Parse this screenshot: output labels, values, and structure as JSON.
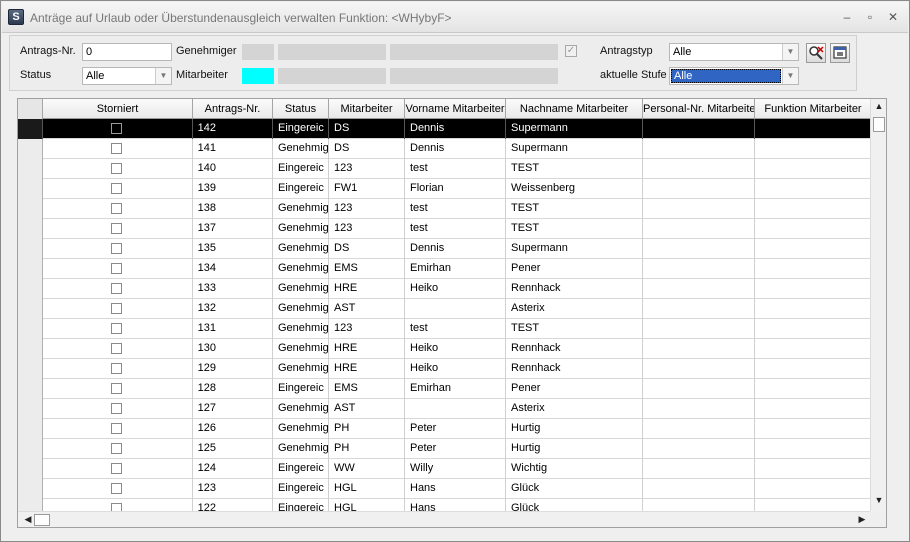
{
  "window": {
    "title": "Anträge auf Urlaub oder Überstundenausgleich verwalten  Funktion: <WHybyF>",
    "app_icon_letter": "S",
    "controls": {
      "minimize": "–",
      "maximize": "▫",
      "close": "✕"
    }
  },
  "filters": {
    "antrags_nr_label": "Antrags-Nr.",
    "antrags_nr_value": "0",
    "status_label": "Status",
    "status_value": "Alle",
    "genehmiger_label": "Genehmiger",
    "mitarbeiter_label": "Mitarbeiter",
    "antragstyp_label": "Antragstyp",
    "antragstyp_value": "Alle",
    "aktuelle_stufe_label": "aktuelle Stufe",
    "aktuelle_stufe_value": "Alle",
    "genehmiger_checked": true,
    "mitarbeiter_color": "#00ffff",
    "search_icon": "search-clear-icon",
    "export_icon": "window-export-icon"
  },
  "grid": {
    "columns": [
      "Storniert",
      "Antrags-Nr.",
      "Status",
      "Mitarbeiter",
      "Vorname Mitarbeiter",
      "Nachname Mitarbeiter",
      "Personal-Nr. Mitarbeiter",
      "Funktion Mitarbeiter"
    ],
    "selected_row": 0,
    "rows": [
      {
        "nr": "142",
        "status": "Eingereic",
        "ma": "DS",
        "vorname": "Dennis",
        "nachname": "Supermann"
      },
      {
        "nr": "141",
        "status": "Genehmig",
        "ma": "DS",
        "vorname": "Dennis",
        "nachname": "Supermann"
      },
      {
        "nr": "140",
        "status": "Eingereic",
        "ma": "123",
        "vorname": "test",
        "nachname": "TEST"
      },
      {
        "nr": "139",
        "status": "Eingereic",
        "ma": "FW1",
        "vorname": "Florian",
        "nachname": "Weissenberg"
      },
      {
        "nr": "138",
        "status": "Genehmig",
        "ma": "123",
        "vorname": "test",
        "nachname": "TEST"
      },
      {
        "nr": "137",
        "status": "Genehmig",
        "ma": "123",
        "vorname": "test",
        "nachname": "TEST"
      },
      {
        "nr": "135",
        "status": "Genehmig",
        "ma": "DS",
        "vorname": "Dennis",
        "nachname": "Supermann"
      },
      {
        "nr": "134",
        "status": "Genehmig",
        "ma": "EMS",
        "vorname": "Emirhan",
        "nachname": "Pener"
      },
      {
        "nr": "133",
        "status": "Genehmig",
        "ma": "HRE",
        "vorname": "Heiko",
        "nachname": "Rennhack"
      },
      {
        "nr": "132",
        "status": "Genehmig",
        "ma": "AST",
        "vorname": "",
        "nachname": "Asterix"
      },
      {
        "nr": "131",
        "status": "Genehmig",
        "ma": "123",
        "vorname": "test",
        "nachname": "TEST"
      },
      {
        "nr": "130",
        "status": "Genehmig",
        "ma": "HRE",
        "vorname": "Heiko",
        "nachname": "Rennhack"
      },
      {
        "nr": "129",
        "status": "Genehmig",
        "ma": "HRE",
        "vorname": "Heiko",
        "nachname": "Rennhack"
      },
      {
        "nr": "128",
        "status": "Eingereic",
        "ma": "EMS",
        "vorname": "Emirhan",
        "nachname": "Pener"
      },
      {
        "nr": "127",
        "status": "Genehmig",
        "ma": "AST",
        "vorname": "",
        "nachname": "Asterix"
      },
      {
        "nr": "126",
        "status": "Genehmig",
        "ma": "PH",
        "vorname": "Peter",
        "nachname": "Hurtig"
      },
      {
        "nr": "125",
        "status": "Genehmig",
        "ma": "PH",
        "vorname": "Peter",
        "nachname": "Hurtig"
      },
      {
        "nr": "124",
        "status": "Eingereic",
        "ma": "WW",
        "vorname": "Willy",
        "nachname": "Wichtig"
      },
      {
        "nr": "123",
        "status": "Eingereic",
        "ma": "HGL",
        "vorname": "Hans",
        "nachname": "Glück"
      },
      {
        "nr": "122",
        "status": "Eingereic",
        "ma": "HGL",
        "vorname": "Hans",
        "nachname": "Glück"
      }
    ]
  }
}
